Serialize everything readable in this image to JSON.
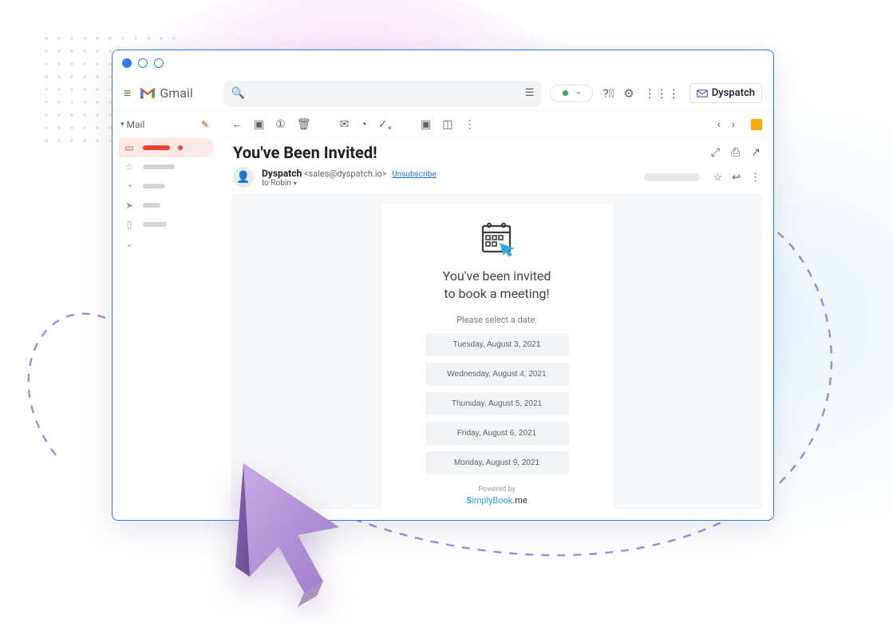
{
  "header": {
    "app_name": "Gmail",
    "search_placeholder": "",
    "dyspatch_label": "Dyspatch"
  },
  "sidebar": {
    "mail_label": "Mail"
  },
  "message": {
    "subject": "You've Been Invited!",
    "sender_name": "Dyspatch",
    "sender_email": "<sales@dyspatch.io>",
    "unsubscribe": "Unsubscribe",
    "to_line": "to Robin"
  },
  "email_body": {
    "title_line1": "You've been invited",
    "title_line2": "to book a meeting!",
    "prompt": "Please select a date:",
    "dates": [
      "Tuesday, August 3, 2021",
      "Wednesday, August 4, 2021",
      "Thursday, August 5, 2021",
      "Friday, August 6, 2021",
      "Monday, August 9, 2021"
    ],
    "powered_by": "Powered by",
    "brand_s": "S",
    "brand_rest": "implyBook",
    "brand_me": ".me"
  }
}
